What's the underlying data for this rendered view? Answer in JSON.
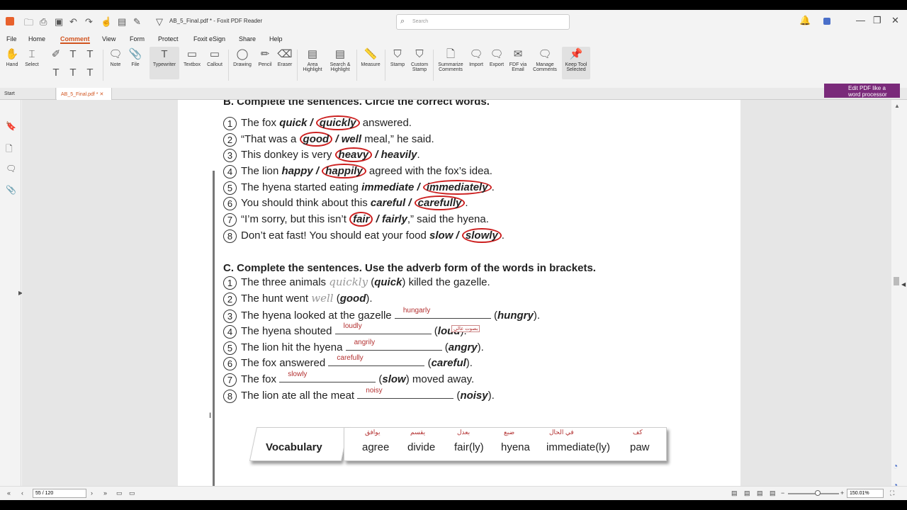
{
  "window": {
    "title": "AB_5_Final.pdf * - Foxit PDF Reader",
    "search_placeholder": "Search"
  },
  "menu": [
    "File",
    "Home",
    "Comment",
    "View",
    "Form",
    "Protect",
    "Foxit eSign",
    "Share",
    "Help"
  ],
  "ribbon": {
    "hand": "Hand",
    "select": "Select",
    "note": "Note",
    "file": "File",
    "typewriter": "Typewriter",
    "textbox": "Textbox",
    "callout": "Callout",
    "drawing": "Drawing",
    "pencil": "Pencil",
    "eraser": "Eraser",
    "area_highlight": "Area Highlight",
    "search_highlight": "Search & Highlight",
    "measure": "Measure",
    "stamp": "Stamp",
    "custom_stamp": "Custom Stamp",
    "summarize": "Summarize Comments",
    "import": "Import",
    "export": "Export",
    "fdf_email": "FDF via Email",
    "manage": "Manage Comments",
    "keep_tool": "Keep Tool Selected"
  },
  "tabs": {
    "start": "Start",
    "doc": "AB_5_Final.pdf *"
  },
  "promo": "Edit PDF like a word processor",
  "section_b": {
    "heading": "B. Complete the sentences. Circle the correct words.",
    "items": [
      {
        "n": "1",
        "pre": "The fox ",
        "a": "quick",
        "sep": " / ",
        "b": "quickly",
        "post": " answered.",
        "circ": "b"
      },
      {
        "n": "2",
        "pre": "“That was a ",
        "a": "good",
        "sep": " / ",
        "b": "well",
        "post": " meal,” he said.",
        "circ": "a"
      },
      {
        "n": "3",
        "pre": "This donkey is very ",
        "a": "heavy",
        "sep": " / ",
        "b": "heavily",
        "post": ".",
        "circ": "a"
      },
      {
        "n": "4",
        "pre": "The lion ",
        "a": "happy",
        "sep": " / ",
        "b": "happily",
        "post": " agreed with the fox’s idea.",
        "circ": "b"
      },
      {
        "n": "5",
        "pre": "The hyena started eating ",
        "a": "immediate",
        "sep": " / ",
        "b": "immediately",
        "post": ".",
        "circ": "b"
      },
      {
        "n": "6",
        "pre": "You should think about this ",
        "a": "careful",
        "sep": " / ",
        "b": "carefully",
        "post": ".",
        "circ": "b"
      },
      {
        "n": "7",
        "pre": "“I’m sorry, but this isn’t ",
        "a": "fair",
        "sep": " / ",
        "b": "fairly",
        "post": ",” said the hyena.",
        "circ": "a"
      },
      {
        "n": "8",
        "pre": "Don’t eat fast! You should eat your food ",
        "a": "slow",
        "sep": " / ",
        "b": "slowly",
        "post": ".",
        "circ": "b"
      }
    ]
  },
  "section_c": {
    "heading": "C. Complete the sentences. Use the adverb form of the words in brackets.",
    "items": [
      {
        "n": "1",
        "pre": "The three animals ",
        "ans": "quickly",
        "word": "quick",
        "post": " killed the gazelle."
      },
      {
        "n": "2",
        "pre": "The hunt went ",
        "ans": "well",
        "word": "good",
        "post": "."
      },
      {
        "n": "3",
        "pre": "The hyena looked at the gazelle ",
        "ans": "hungarly",
        "word": "hungry",
        "post": "."
      },
      {
        "n": "4",
        "pre": "The hyena shouted ",
        "ans": "loudly",
        "word": "loud",
        "post": "."
      },
      {
        "n": "5",
        "pre": "The lion hit the hyena ",
        "ans": "angrily",
        "word": "angry",
        "post": "."
      },
      {
        "n": "6",
        "pre": "The fox answered ",
        "ans": "carefully",
        "word": "careful",
        "post": "."
      },
      {
        "n": "7",
        "pre": "The fox ",
        "ans": "slowly",
        "word": "slow",
        "post": " moved away."
      },
      {
        "n": "8",
        "pre": "The lion ate all the meat ",
        "ans": "noisy",
        "word": "noisy",
        "post": "."
      }
    ],
    "note": "بصوت عالي"
  },
  "vocab": {
    "label": "Vocabulary",
    "words": [
      {
        "en": "agree",
        "ar": "يوافق"
      },
      {
        "en": "divide",
        "ar": "يقسم"
      },
      {
        "en": "fair(ly)",
        "ar": "بعدل"
      },
      {
        "en": "hyena",
        "ar": "ضبع"
      },
      {
        "en": "immediate(ly)",
        "ar": "في الحال"
      },
      {
        "en": "paw",
        "ar": "كف"
      }
    ]
  },
  "status": {
    "page": "55 / 120",
    "zoom": "150.01%"
  }
}
